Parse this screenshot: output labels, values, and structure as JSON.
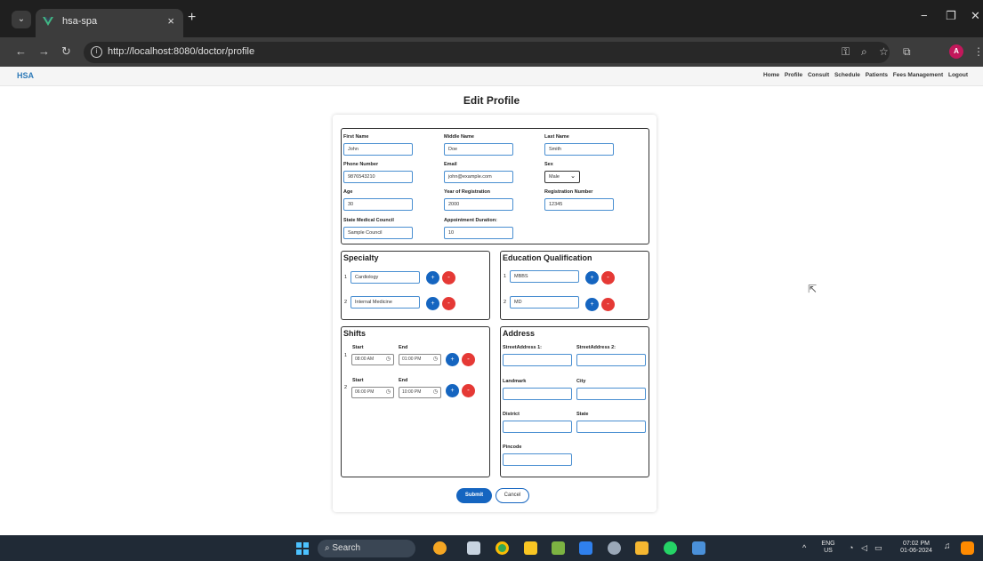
{
  "browser": {
    "tab_title": "hsa-spa",
    "url": "http://localhost:8080/doctor/profile",
    "avatar_letter": "A"
  },
  "app": {
    "brand": "HSA",
    "nav": [
      "Home",
      "Profile",
      "Consult",
      "Schedule",
      "Patients",
      "Fees Management",
      "Logout"
    ]
  },
  "page_title": "Edit Profile",
  "basic": {
    "first_name": {
      "label": "First Name",
      "value": "John"
    },
    "middle_name": {
      "label": "Middle Name",
      "value": "Doe"
    },
    "last_name": {
      "label": "Last Name",
      "value": "Smith"
    },
    "phone": {
      "label": "Phone Number",
      "value": "9876543210"
    },
    "email": {
      "label": "Email",
      "value": "john@example.com"
    },
    "sex": {
      "label": "Sex",
      "value": "Male"
    },
    "age": {
      "label": "Age",
      "value": "30"
    },
    "year_reg": {
      "label": "Year of Registration",
      "value": "2000"
    },
    "reg_number": {
      "label": "Registration Number",
      "value": "12345"
    },
    "council": {
      "label": "State Medical Council",
      "value": "Sample Council"
    },
    "appt_duration": {
      "label": "Appointment Duration:",
      "value": "10"
    }
  },
  "specialty": {
    "title": "Specialty",
    "items": [
      {
        "index": "1",
        "value": "Cardiology"
      },
      {
        "index": "2",
        "value": "Internal Medicine"
      }
    ]
  },
  "education": {
    "title": "Education Qualification",
    "items": [
      {
        "index": "1",
        "value": "MBBS"
      },
      {
        "index": "2",
        "value": "MD"
      }
    ]
  },
  "shifts": {
    "title": "Shifts",
    "start_label": "Start",
    "end_label": "End",
    "items": [
      {
        "index": "1",
        "start": "08:00 AM",
        "end": "01:00 PM"
      },
      {
        "index": "2",
        "start": "06:00 PM",
        "end": "10:00 PM"
      }
    ]
  },
  "address": {
    "title": "Address",
    "street1": "StreetAddress 1:",
    "street2": "StreetAddress 2:",
    "landmark": "Landmark",
    "city": "City",
    "district": "District",
    "state": "State",
    "pincode": "Pincode"
  },
  "buttons": {
    "submit": "Submit",
    "cancel": "Cancel",
    "plus": "+",
    "minus": "-"
  },
  "taskbar": {
    "search": "Search",
    "lang_top": "ENG",
    "lang_bottom": "US",
    "time": "07:02 PM",
    "date": "01-06-2024"
  }
}
